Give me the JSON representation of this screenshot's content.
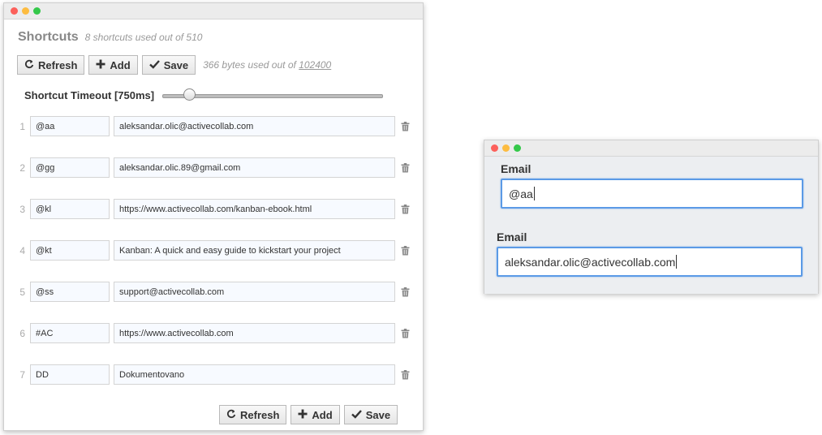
{
  "shortcuts_window": {
    "title": "Shortcuts",
    "subtitle": "8 shortcuts used out of 510",
    "toolbar": {
      "refresh_label": "Refresh",
      "add_label": "Add",
      "save_label": "Save",
      "bytes_prefix": "366 bytes used out of",
      "bytes_limit": "102400"
    },
    "timeout": {
      "label": "Shortcut Timeout [750ms]",
      "slider_fraction": 0.1
    },
    "rows": [
      {
        "index": "1",
        "key": "@aa",
        "value": "aleksandar.olic@activecollab.com"
      },
      {
        "index": "2",
        "key": "@gg",
        "value": "aleksandar.olic.89@gmail.com"
      },
      {
        "index": "3",
        "key": "@kl",
        "value": "https://www.activecollab.com/kanban-ebook.html"
      },
      {
        "index": "4",
        "key": "@kt",
        "value": "Kanban: A quick and easy guide to kickstart your project"
      },
      {
        "index": "5",
        "key": "@ss",
        "value": "support@activecollab.com"
      },
      {
        "index": "6",
        "key": "#AC",
        "value": "https://www.activecollab.com"
      },
      {
        "index": "7",
        "key": "DD",
        "value": "Dokumentovano"
      }
    ],
    "footer": {
      "refresh_label": "Refresh",
      "add_label": "Add",
      "save_label": "Save"
    }
  },
  "email_window": {
    "field1_label": "Email",
    "field1_value": "@aa",
    "field2_label": "Email",
    "field2_value": "aleksandar.olic@activecollab.com"
  },
  "icons": {
    "refresh": "refresh-icon",
    "add": "plus-icon",
    "save": "checkmark-icon",
    "delete": "trash-icon"
  },
  "colors": {
    "focus_border": "#5b9ae6",
    "window_close": "#fc605b",
    "window_minimize": "#fdbc40",
    "window_zoom": "#34c84a"
  }
}
